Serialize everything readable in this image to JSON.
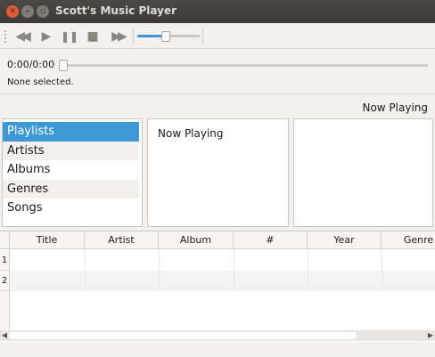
{
  "window": {
    "title": "Scott's Music Player"
  },
  "toolbar": {
    "prev_icon": "rewind-icon",
    "play_icon": "play-icon",
    "pause_icon": "pause-icon",
    "stop_icon": "stop-icon",
    "next_icon": "fast-forward-icon",
    "volume_level": 0.45,
    "glyphs": {
      "prev": "◀◀",
      "play": "▶",
      "pause": "❚❚",
      "stop": "■",
      "next": "▶▶"
    }
  },
  "playback": {
    "time": "0:00/0:00",
    "status": "None selected.",
    "seek_position": 0
  },
  "now_playing_header": "Now Playing",
  "library": {
    "items": [
      {
        "label": "Playlists",
        "selected": true
      },
      {
        "label": "Artists",
        "selected": false
      },
      {
        "label": "Albums",
        "selected": false
      },
      {
        "label": "Genres",
        "selected": false
      },
      {
        "label": "Songs",
        "selected": false
      }
    ]
  },
  "middle_pane": {
    "items": [
      "Now Playing"
    ]
  },
  "track_table": {
    "columns": [
      "Title",
      "Artist",
      "Album",
      "#",
      "Year",
      "Genre"
    ],
    "row_numbers": [
      "1",
      "2"
    ]
  },
  "colors": {
    "accent": "#3d98d6",
    "titlebar": "#3c3b37",
    "close_button": "#e05a33"
  }
}
